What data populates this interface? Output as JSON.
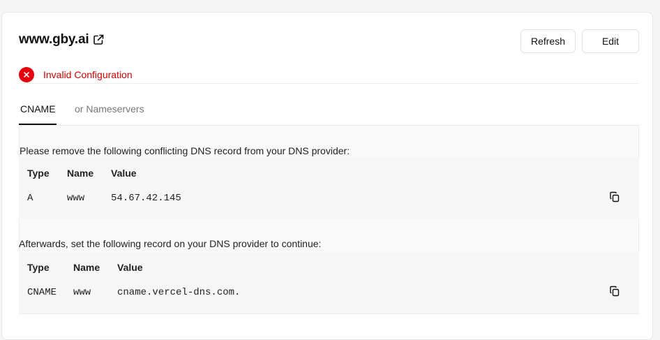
{
  "domain": {
    "name": "www.gby.ai",
    "link_icon": "external-link-icon"
  },
  "actions": {
    "refresh_label": "Refresh",
    "edit_label": "Edit"
  },
  "status": {
    "icon": "error-circle-icon",
    "text": "Invalid Configuration",
    "color": "#e5000b"
  },
  "tabs": [
    {
      "label": "CNAME",
      "active": true
    },
    {
      "label": "or Nameservers",
      "active": false
    }
  ],
  "conflict": {
    "instruction": "Please remove the following conflicting DNS record from your DNS provider:",
    "headers": {
      "type": "Type",
      "name": "Name",
      "value": "Value"
    },
    "record": {
      "type": "A",
      "name": "www",
      "value": "54.67.42.145"
    },
    "copy_icon": "copy-icon"
  },
  "required": {
    "instruction": "Afterwards, set the following record on your DNS provider to continue:",
    "headers": {
      "type": "Type",
      "name": "Name",
      "value": "Value"
    },
    "record": {
      "type": "CNAME",
      "name": "www",
      "value": "cname.vercel-dns.com."
    },
    "copy_icon": "copy-icon"
  }
}
